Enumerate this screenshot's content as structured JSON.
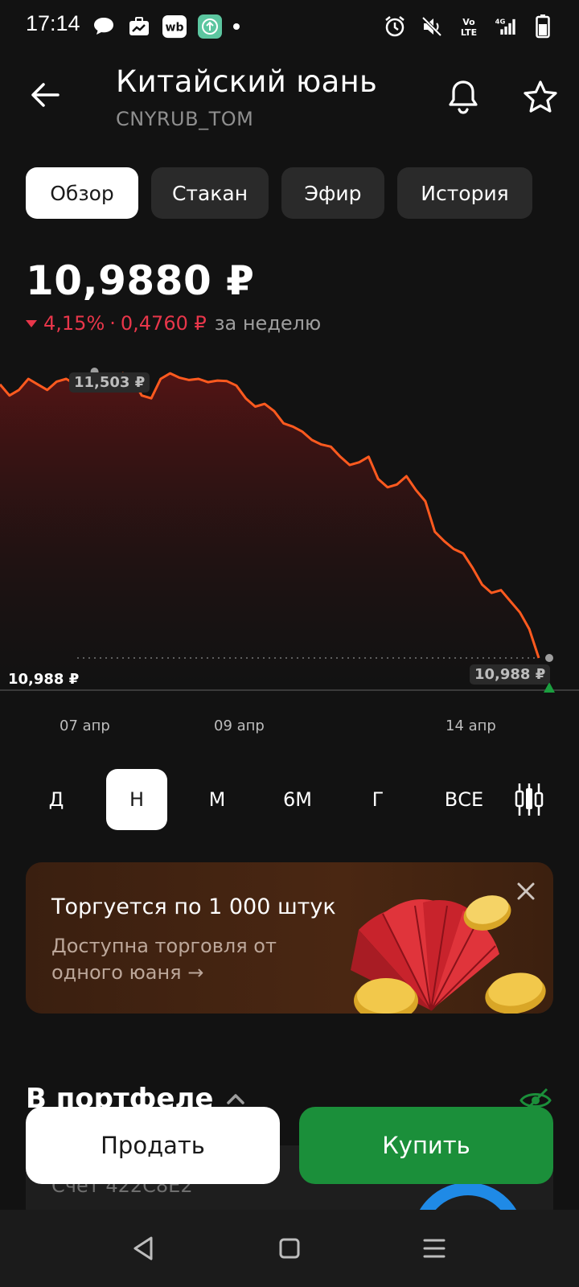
{
  "status_bar": {
    "time": "17:14",
    "left_icons": [
      "chat-bubble-icon",
      "briefcase-chart-icon",
      "wb-app-icon",
      "upload-app-icon"
    ],
    "right_icons": [
      "alarm-icon",
      "mute-icon",
      "volte-icon",
      "signal-icon",
      "battery-icon"
    ],
    "volte_label": "Vo\nLTE",
    "network_label": "4G"
  },
  "header": {
    "title": "Китайский юань",
    "ticker": "CNYRUB_TOM"
  },
  "tabs": [
    {
      "label": "Обзор",
      "active": true
    },
    {
      "label": "Стакан",
      "active": false
    },
    {
      "label": "Эфир",
      "active": false
    },
    {
      "label": "История",
      "active": false
    }
  ],
  "price": {
    "value": "10,9880 ₽",
    "change_percent": "4,15%",
    "separator": "·",
    "change_abs": "0,4760 ₽",
    "period": "за неделю"
  },
  "chart_data": {
    "type": "area",
    "x_labels": [
      "07 апр",
      "09 апр",
      "14 апр"
    ],
    "max_label": "11,503 ₽",
    "min_label_left": "10,988 ₽",
    "last_label": "10,988 ₽",
    "y": [
      11.48,
      11.46,
      11.47,
      11.49,
      11.48,
      11.47,
      11.485,
      11.49,
      11.48,
      11.492,
      11.503,
      11.495,
      11.48,
      11.5,
      11.49,
      11.46,
      11.455,
      11.49,
      11.5,
      11.492,
      11.488,
      11.49,
      11.484,
      11.487,
      11.486,
      11.478,
      11.455,
      11.44,
      11.445,
      11.432,
      11.41,
      11.404,
      11.395,
      11.38,
      11.372,
      11.368,
      11.35,
      11.335,
      11.34,
      11.35,
      11.31,
      11.295,
      11.3,
      11.315,
      11.29,
      11.27,
      11.215,
      11.198,
      11.184,
      11.176,
      11.15,
      11.12,
      11.105,
      11.11,
      11.09,
      11.07,
      11.04,
      10.988
    ],
    "line_color": "#ff5a1f",
    "trend": "down"
  },
  "periods": [
    {
      "label": "Д",
      "active": false
    },
    {
      "label": "Н",
      "active": true
    },
    {
      "label": "М",
      "active": false
    },
    {
      "label": "6М",
      "active": false
    },
    {
      "label": "Г",
      "active": false
    },
    {
      "label": "ВСЕ",
      "active": false
    }
  ],
  "banner": {
    "title": "Торгуется по 1 000 штук",
    "subtitle": "Доступна торговля от одного юаня →"
  },
  "portfolio": {
    "title": "В портфеле",
    "account": "Счет 422C8E2"
  },
  "actions": {
    "sell": "Продать",
    "buy": "Купить"
  },
  "colors": {
    "background": "#121212",
    "negative": "#e8364a",
    "buy": "#1b8f3a",
    "chart_line": "#ff5a1f"
  }
}
